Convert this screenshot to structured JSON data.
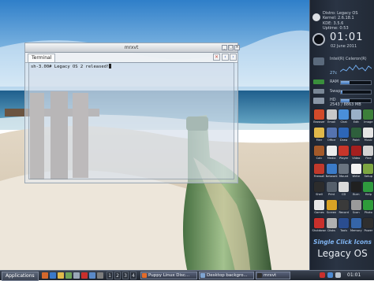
{
  "terminal": {
    "title": "mrxvt",
    "tab_label": "Terminal",
    "prompt_line": "sh-3.00# Legacy OS 2 released!"
  },
  "sidepanel": {
    "sysinfo": [
      "Distro: Legacy OS",
      "Kernel: 2.6.18.1",
      "KDE: 3.5.6",
      "Uptime: 0:53"
    ],
    "clock_time": "01:01",
    "clock_date": "02 June 2011",
    "cpu_label": "Intel(R) Celeron(R)",
    "cpu_temp": "27c",
    "ram_label": "RAM",
    "swap_label": "Swap",
    "hd_label": "HD",
    "memory_text": "2543 / 8863 MB",
    "ram_fill": 0.3,
    "swap_fill": 0.05,
    "hd_fill": 0.29,
    "apps": [
      {
        "label": "Browser",
        "color": "#d24a2a"
      },
      {
        "label": "Email",
        "color": "#c8c8c8"
      },
      {
        "label": "Chat",
        "color": "#4a8fd9"
      },
      {
        "label": "Edit",
        "color": "#9ab0c8"
      },
      {
        "label": "Image",
        "color": "#3c7f3a"
      },
      {
        "label": "Filer",
        "color": "#e0b84a"
      },
      {
        "label": "Office",
        "color": "#5573b0"
      },
      {
        "label": "Draw",
        "color": "#2d66b8"
      },
      {
        "label": "Paint",
        "color": "#2e5f3c"
      },
      {
        "label": "Music",
        "color": "#e5e5e5"
      },
      {
        "label": "Calc",
        "color": "#a45a2a"
      },
      {
        "label": "Media",
        "color": "#ececec"
      },
      {
        "label": "Player",
        "color": "#c9362a"
      },
      {
        "label": "Video",
        "color": "#a41f1f"
      },
      {
        "label": "Find",
        "color": "#d3d3d3"
      },
      {
        "label": "Firewall",
        "color": "#c0392b"
      },
      {
        "label": "Network",
        "color": "#3b7bc8"
      },
      {
        "label": "Mount",
        "color": "#6a7480"
      },
      {
        "label": "Write",
        "color": "#f2f2f2"
      },
      {
        "label": "Setup",
        "color": "#7da642"
      },
      {
        "label": "Shell",
        "color": "#2c2c2c"
      },
      {
        "label": "Print",
        "color": "#555f6b"
      },
      {
        "label": "CD",
        "color": "#dadada"
      },
      {
        "label": "Burn",
        "color": "#202020"
      },
      {
        "label": "Help",
        "color": "#2f9a3e"
      },
      {
        "label": "Games",
        "color": "#e7e7e7"
      },
      {
        "label": "Screen",
        "color": "#d9a225"
      },
      {
        "label": "Record",
        "color": "#3a3a3a"
      },
      {
        "label": "Scan",
        "color": "#9a9a9a"
      },
      {
        "label": "Photo",
        "color": "#2e9b3a"
      },
      {
        "label": "Shutdown",
        "color": "#c9302c"
      },
      {
        "label": "Disks",
        "color": "#b0b0b0"
      },
      {
        "label": "Tools",
        "color": "#2a4d8f"
      },
      {
        "label": "Memory",
        "color": "#3565a8"
      },
      {
        "label": "Power",
        "color": "#2f2f2f"
      }
    ],
    "single_click": "Single Click Icons",
    "brand": "Legacy OS"
  },
  "taskbar": {
    "start_label": "Applications",
    "workspaces": [
      "1",
      "2",
      "3",
      "4"
    ],
    "tasks": [
      "Puppy Linux Disc...",
      "Desktop backgro...",
      "mrxvt"
    ],
    "clock": "01:01"
  }
}
